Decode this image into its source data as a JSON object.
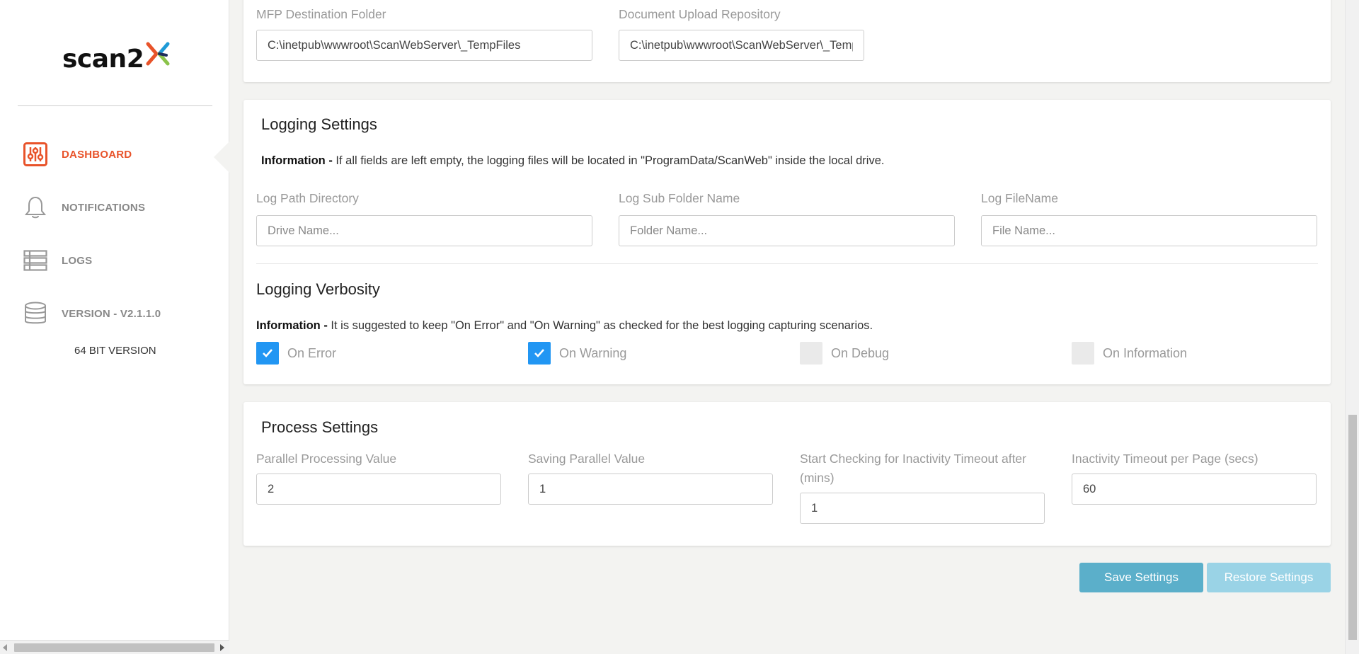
{
  "brand": {
    "logo_text": "scan2",
    "accent": "#e8532a",
    "primary": "#2196f3"
  },
  "sidebar": {
    "items": [
      {
        "label": "DASHBOARD",
        "icon": "sliders-icon",
        "active": true
      },
      {
        "label": "NOTIFICATIONS",
        "icon": "bell-icon",
        "active": false
      },
      {
        "label": "LOGS",
        "icon": "list-icon",
        "active": false
      },
      {
        "label": "VERSION - V2.1.1.0",
        "icon": "database-icon",
        "active": false
      }
    ],
    "bit_version": "64 BIT VERSION"
  },
  "folders": {
    "mfp_label": "MFP Destination Folder",
    "mfp_value": "C:\\inetpub\\wwwroot\\ScanWebServer\\_TempFiles",
    "upload_label": "Document Upload Repository",
    "upload_value": "C:\\inetpub\\wwwroot\\ScanWebServer\\_TempFiles"
  },
  "logging": {
    "title": "Logging Settings",
    "info_bold": "Information - ",
    "info_text": "If all fields are left empty, the logging files will be located in \"ProgramData/ScanWeb\" inside the local drive.",
    "path_label": "Log Path Directory",
    "path_placeholder": "Drive Name...",
    "sub_label": "Log Sub Folder Name",
    "sub_placeholder": "Folder Name...",
    "file_label": "Log FileName",
    "file_placeholder": "File Name..."
  },
  "verbosity": {
    "title": "Logging Verbosity",
    "info_bold": "Information - ",
    "info_text": "It is suggested to keep \"On Error\" and \"On Warning\" as checked for the best logging capturing scenarios.",
    "options": [
      {
        "label": "On Error",
        "checked": true
      },
      {
        "label": "On Warning",
        "checked": true
      },
      {
        "label": "On Debug",
        "checked": false
      },
      {
        "label": "On Information",
        "checked": false
      }
    ]
  },
  "process": {
    "title": "Process Settings",
    "parallel_label": "Parallel Processing Value",
    "parallel_value": "2",
    "saving_label": "Saving Parallel Value",
    "saving_value": "1",
    "inactivity_start_label": "Start Checking for Inactivity Timeout after (mins)",
    "inactivity_start_value": "1",
    "timeout_label": "Inactivity Timeout per Page (secs)",
    "timeout_value": "60"
  },
  "actions": {
    "save_label": "Save Settings",
    "restore_label": "Restore Settings"
  }
}
